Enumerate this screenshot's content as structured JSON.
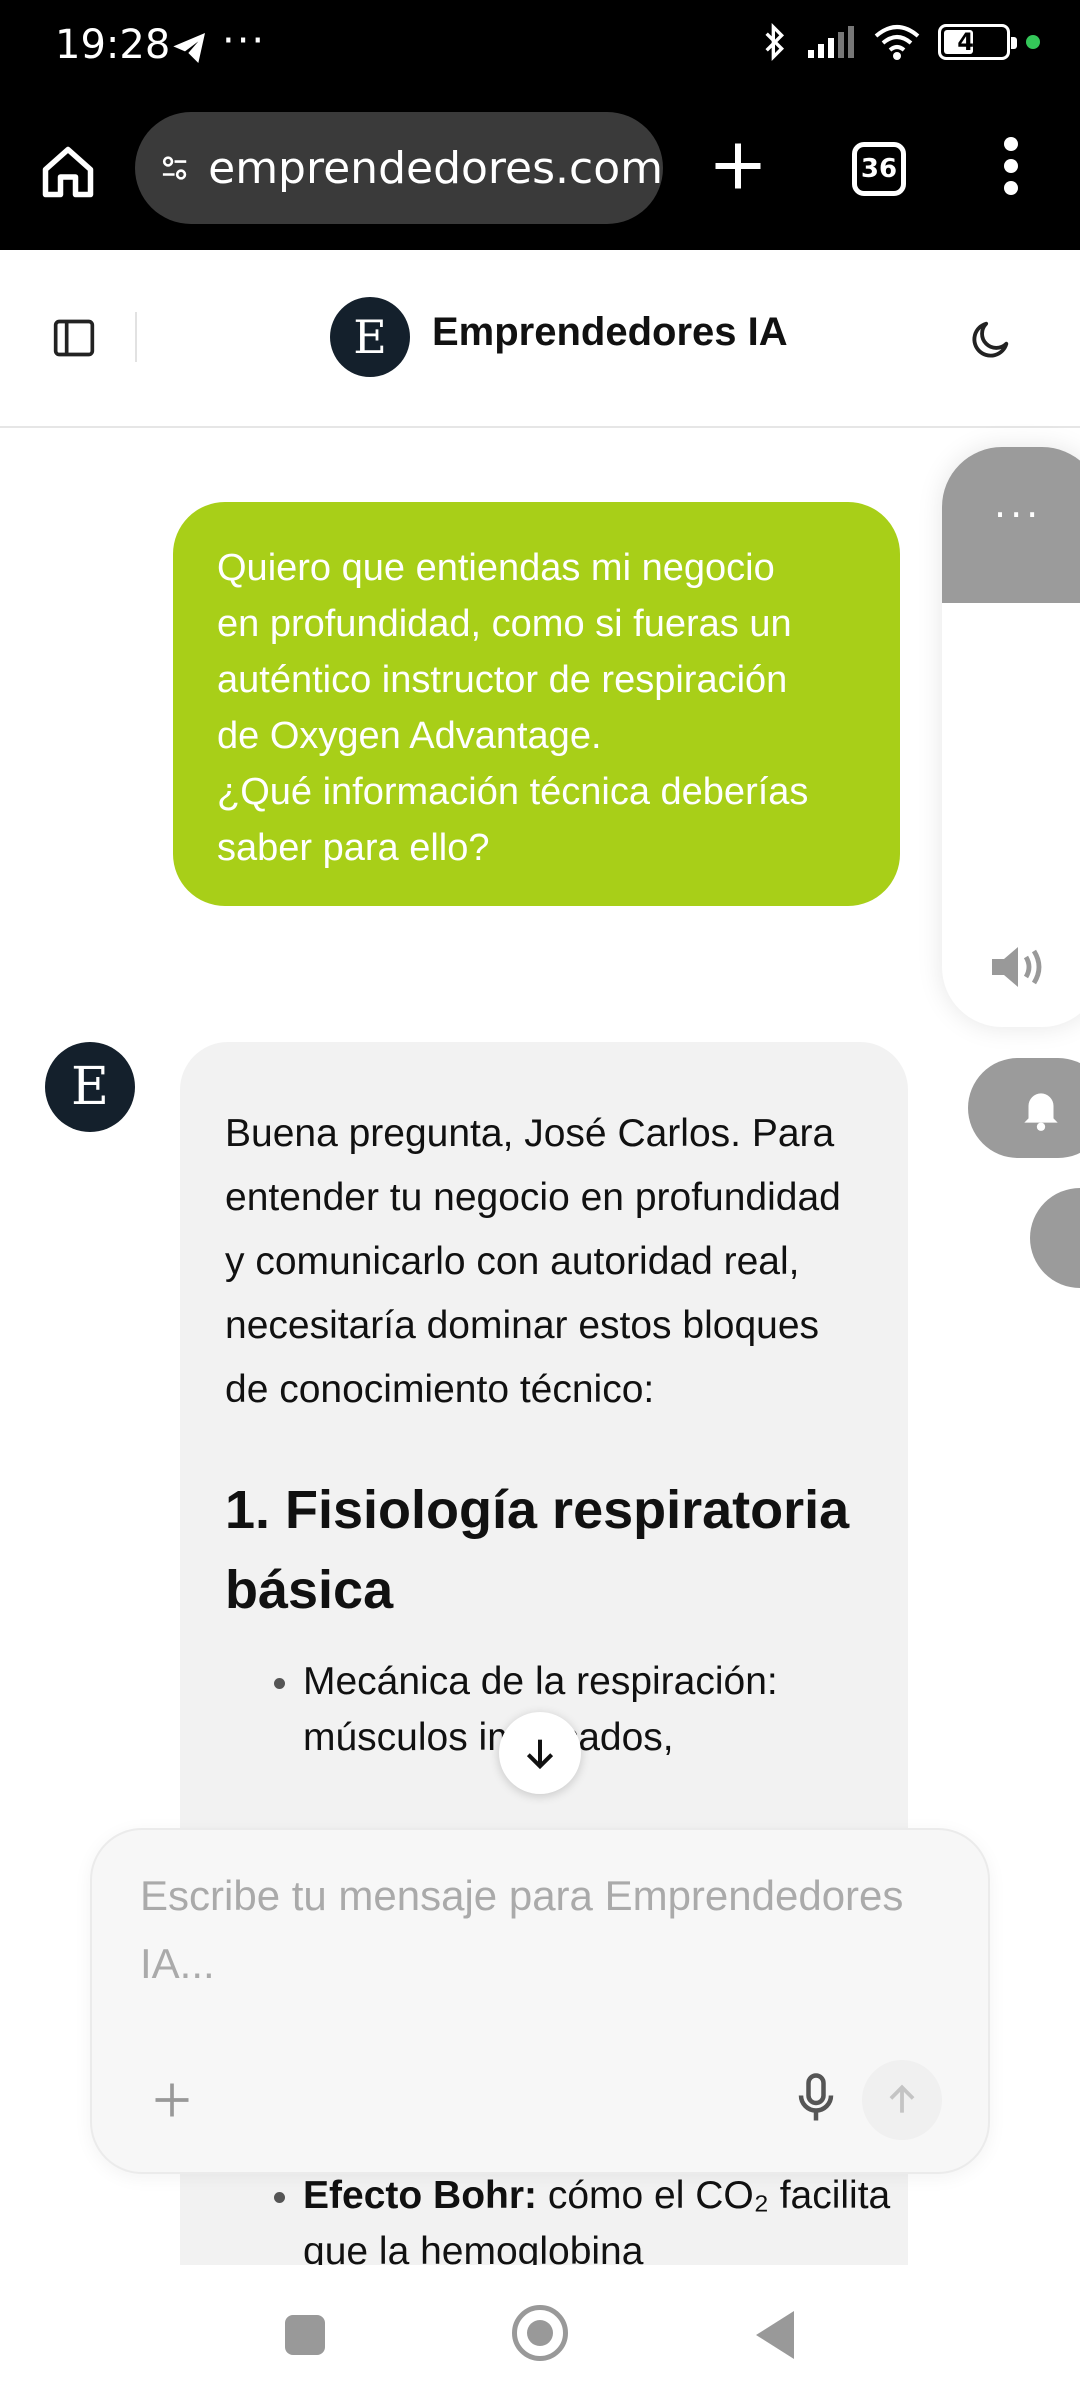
{
  "status_bar": {
    "time": "19:28",
    "more": "···",
    "battery": "49",
    "battery_level": 0.49
  },
  "browser": {
    "url": "emprendedores.com",
    "tabs_count": "36"
  },
  "header": {
    "logo_letter": "E",
    "title": "Emprendedores IA"
  },
  "chat": {
    "user_message_lines": [
      "Quiero que entiendas mi negocio",
      "en profundidad, como si fueras un",
      "auténtico instructor de respiración",
      "de Oxygen Advantage.",
      "¿Qué información técnica deberías",
      "saber para ello?"
    ],
    "assistant_avatar": "E",
    "assistant_intro": "Buena pregunta, José Carlos. Para entender tu negocio en profundidad y comunicarlo con autoridad real, necesitaría dominar estos bloques de conocimiento técnico:",
    "section_1_heading": "1. Fisiología respiratoria básica",
    "bullet_1": "Mecánica de la respiración: músculos implicados,",
    "bullet_bohr_label": "Efecto Bohr:",
    "bullet_bohr_text": " cómo el CO₂ facilita que la hemoglobina"
  },
  "side_panel": {
    "dots": "···"
  },
  "composer": {
    "placeholder": "Escribe tu mensaje para Emprendedores IA..."
  }
}
